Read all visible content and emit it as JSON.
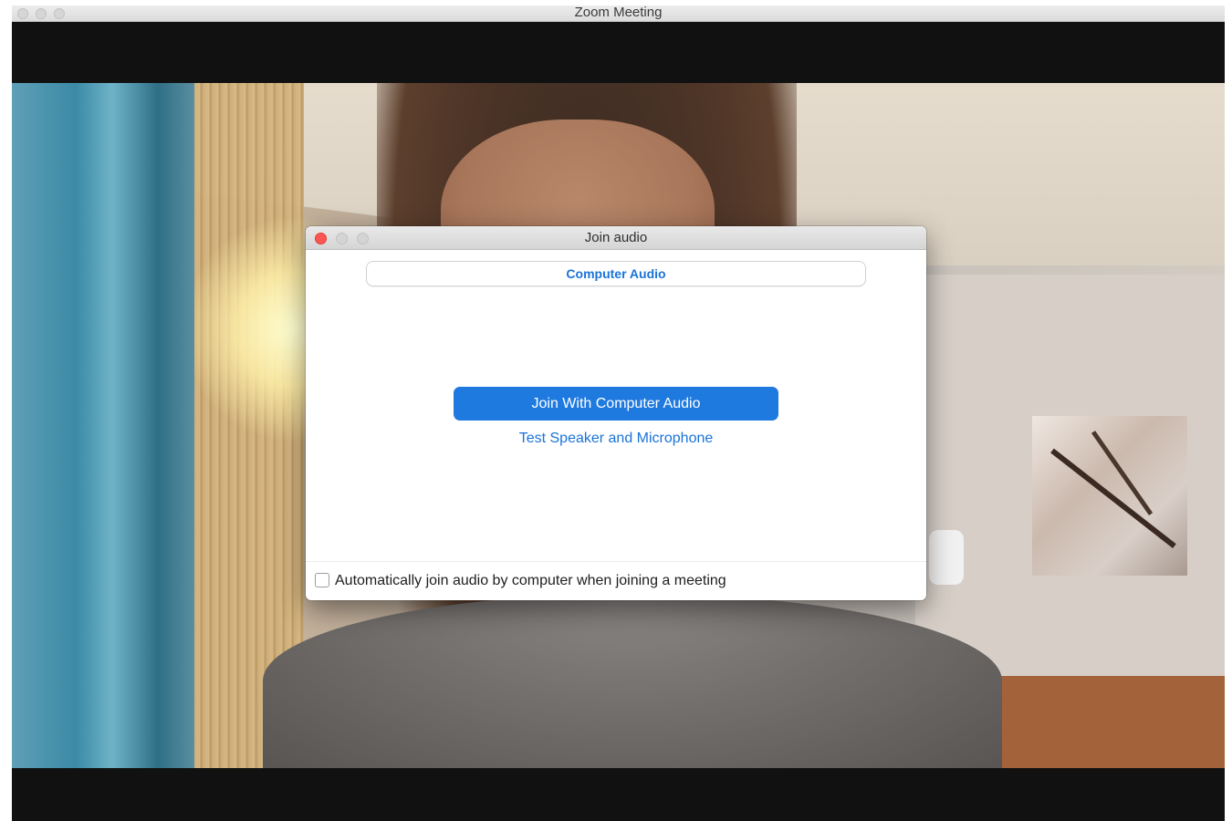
{
  "window": {
    "title": "Zoom Meeting"
  },
  "dialog": {
    "title": "Join audio",
    "tab_label": "Computer Audio",
    "join_button_label": "Join With Computer Audio",
    "test_link_label": "Test Speaker and Microphone",
    "auto_join_label": "Automatically join audio by computer when joining a meeting",
    "auto_join_checked": false
  },
  "colors": {
    "accent": "#1f7ae0",
    "link": "#1a73d9",
    "close_light": "#fc5753"
  },
  "icons": [
    "close-icon",
    "minimize-icon",
    "zoom-icon"
  ]
}
